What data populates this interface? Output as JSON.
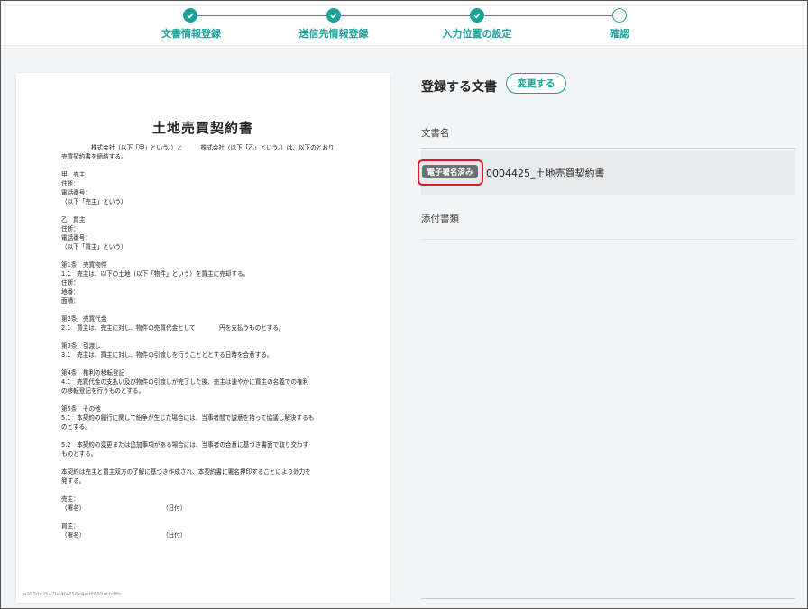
{
  "stepper": {
    "steps": [
      {
        "label": "文書情報登録",
        "state": "done"
      },
      {
        "label": "送信先情報登録",
        "state": "done"
      },
      {
        "label": "入力位置の設定",
        "state": "done"
      },
      {
        "label": "確認",
        "state": "current"
      }
    ],
    "accent_color": "#19a39a"
  },
  "document_preview": {
    "title": "土地売買契約書",
    "body": "　　　　　株式会社（以下「甲」という。）と　　　株式会社（以下「乙」という。）は、以下のとおり\n売買契約書を締結する。\n\n甲　売主\n住所：\n電話番号：\n（以下「売主」という）\n\n乙　買主\n住所：\n電話番号：\n（以下「買主」という）\n\n第1条　売買物件\n1.1　売主は、以下の土地（以下「物件」という）を買主に売却する。\n住所：\n地番：\n面積：\n\n第2条　売買代金\n2.1　買主は、売主に対し、物件の売買代金として　　　　円を支払うものとする。\n\n第3条　引渡し\n3.1　売主は、買主に対し、物件の引渡しを行うことととする日時を合意する。\n\n第4条　権利の移転登記\n4.1　売買代金の支払い及び物件の引渡しが完了した後、売主は速やかに買主の名義での権利\nの移転登記を行うものとする。\n\n第5条　その他\n5.1　本契約の履行に関して紛争が生じた場合には、当事者間で誠意を持って協議し解決するも\nのとする。\n\n5.2　本契約の変更または追加事項がある場合には、当事者の合意に基づき書面で取り交わす\nものとする。\n\n本契約は売主と買主双方の了解に基づき作成され、本契約書に署名押印することにより効力を\n発する。\n\n売主：\n（署名）　　　　　　　　　　　　　　（日付）\n\n買主：\n（署名）　　　　　　　　　　　　　　（日付）",
    "hash": "e993de25e7bc4fa756e4ad8689acb98b"
  },
  "panel": {
    "title": "登録する文書",
    "change_button": "変更する",
    "doc_name_label": "文書名",
    "badge": "電子署名済み",
    "document_name": "0004425_土地売買契約書",
    "attachments_label": "添付書類",
    "badge_highlight_color": "#e0191f"
  }
}
